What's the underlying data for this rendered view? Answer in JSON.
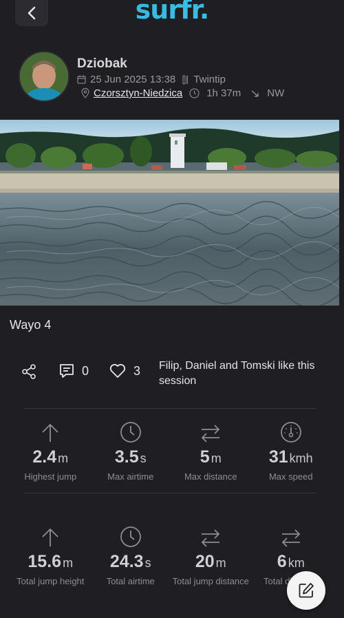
{
  "header": {
    "logo": "surfr.",
    "back_icon": "chevron-left-icon"
  },
  "session": {
    "user": {
      "name": "Dziobak"
    },
    "date": "25 Jun 2025 13:38",
    "board": "Twintip",
    "location": "Czorsztyn-Niedzica",
    "duration": "1h 37m",
    "wind_direction": "NW",
    "title": "Wayo 4"
  },
  "social": {
    "comments_count": "0",
    "likes_count": "3",
    "likes_text": "Filip, Daniel and Tomski like this session"
  },
  "stats_top": [
    {
      "value": "2.4",
      "unit": "m",
      "label": "Highest jump",
      "icon": "arrow-up-icon"
    },
    {
      "value": "3.5",
      "unit": "s",
      "label": "Max airtime",
      "icon": "clock-icon"
    },
    {
      "value": "5",
      "unit": "m",
      "label": "Max distance",
      "icon": "swap-arrows-icon"
    },
    {
      "value": "31",
      "unit": "kmh",
      "label": "Max speed",
      "icon": "speedometer-icon"
    }
  ],
  "stats_bottom": [
    {
      "value": "15.6",
      "unit": "m",
      "label": "Total jump height",
      "icon": "arrow-up-icon"
    },
    {
      "value": "24.3",
      "unit": "s",
      "label": "Total airtime",
      "icon": "clock-icon"
    },
    {
      "value": "20",
      "unit": "m",
      "label": "Total jump distance",
      "icon": "swap-arrows-icon"
    },
    {
      "value": "6",
      "unit": "km",
      "label": "Total distance",
      "icon": "swap-arrows-icon"
    }
  ],
  "colors": {
    "background": "#1f1e23",
    "brand": "#2fb5e6",
    "muted": "#8d8d93"
  }
}
